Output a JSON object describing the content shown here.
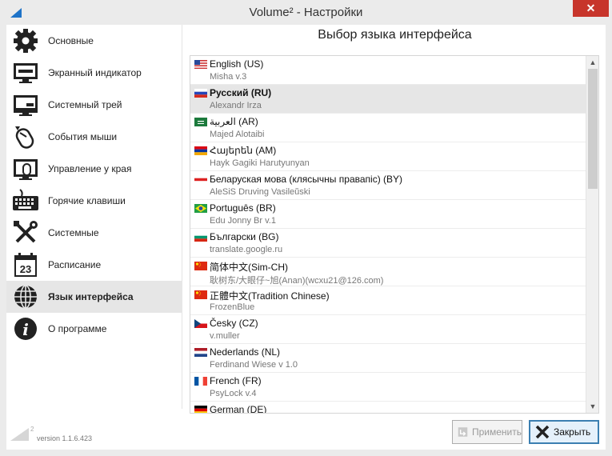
{
  "window": {
    "title": "Volume² - Настройки",
    "close_glyph": "✕"
  },
  "sidebar": {
    "items": [
      {
        "label": "Основные",
        "icon": "gear-icon"
      },
      {
        "label": "Экранный индикатор",
        "icon": "monitor-icon"
      },
      {
        "label": "Системный трей",
        "icon": "tray-icon"
      },
      {
        "label": "События мыши",
        "icon": "mouse-icon"
      },
      {
        "label": "Управление у края",
        "icon": "screen-edge-icon"
      },
      {
        "label": "Горячие клавиши",
        "icon": "keyboard-icon"
      },
      {
        "label": "Системные",
        "icon": "tools-icon"
      },
      {
        "label": "Расписание",
        "icon": "calendar-icon",
        "calendar_day": "23"
      },
      {
        "label": "Язык интерфейса",
        "icon": "globe-icon",
        "active": true
      },
      {
        "label": "О программе",
        "icon": "info-icon",
        "info_glyph": "i"
      }
    ]
  },
  "main": {
    "heading": "Выбор языка интерфейса",
    "languages": [
      {
        "name": "English (US)",
        "author": "Misha v.3",
        "flag": "us"
      },
      {
        "name": "Русский (RU)",
        "author": "Alexandr Irza",
        "flag": "ru",
        "selected": true
      },
      {
        "name": "العربية (AR)",
        "author": "Majed Alotaibi",
        "flag": "sa"
      },
      {
        "name": "Հայերեն (AM)",
        "author": "Hayk Gagiki Harutyunyan",
        "flag": "am"
      },
      {
        "name": "Беларуская мова (клясычны правапіс) (BY)",
        "author": "AleSiS Druving Vasileŭski",
        "flag": "by"
      },
      {
        "name": "Português (BR)",
        "author": "Edu Jonny Br v.1",
        "flag": "br"
      },
      {
        "name": "Български (BG)",
        "author": "translate.google.ru",
        "flag": "bg"
      },
      {
        "name": "简体中文(Sim-CH)",
        "author": "耿树东/大眼仔~旭(Anan)(wcxu21@126.com)",
        "flag": "cn"
      },
      {
        "name": "正體中文(Tradition Chinese)",
        "author": "FrozenBlue",
        "flag": "cn"
      },
      {
        "name": "Česky (CZ)",
        "author": "v.muller",
        "flag": "cz"
      },
      {
        "name": "Nederlands (NL)",
        "author": "Ferdinand Wiese v 1.0",
        "flag": "nl"
      },
      {
        "name": "French (FR)",
        "author": "PsyLock v.4",
        "flag": "fr"
      },
      {
        "name": "German (DE)",
        "author": "",
        "flag": "de"
      }
    ],
    "scroll_up_glyph": "▲",
    "scroll_down_glyph": "▼"
  },
  "footer": {
    "logo_superscript": "2",
    "version": "version 1.1.6.423",
    "apply_label": "Применить",
    "close_label": "Закрыть"
  },
  "colors": {
    "close_button": "#c7352b",
    "selected_row": "#e6e6e6",
    "focus_border": "#3c7fb1"
  }
}
